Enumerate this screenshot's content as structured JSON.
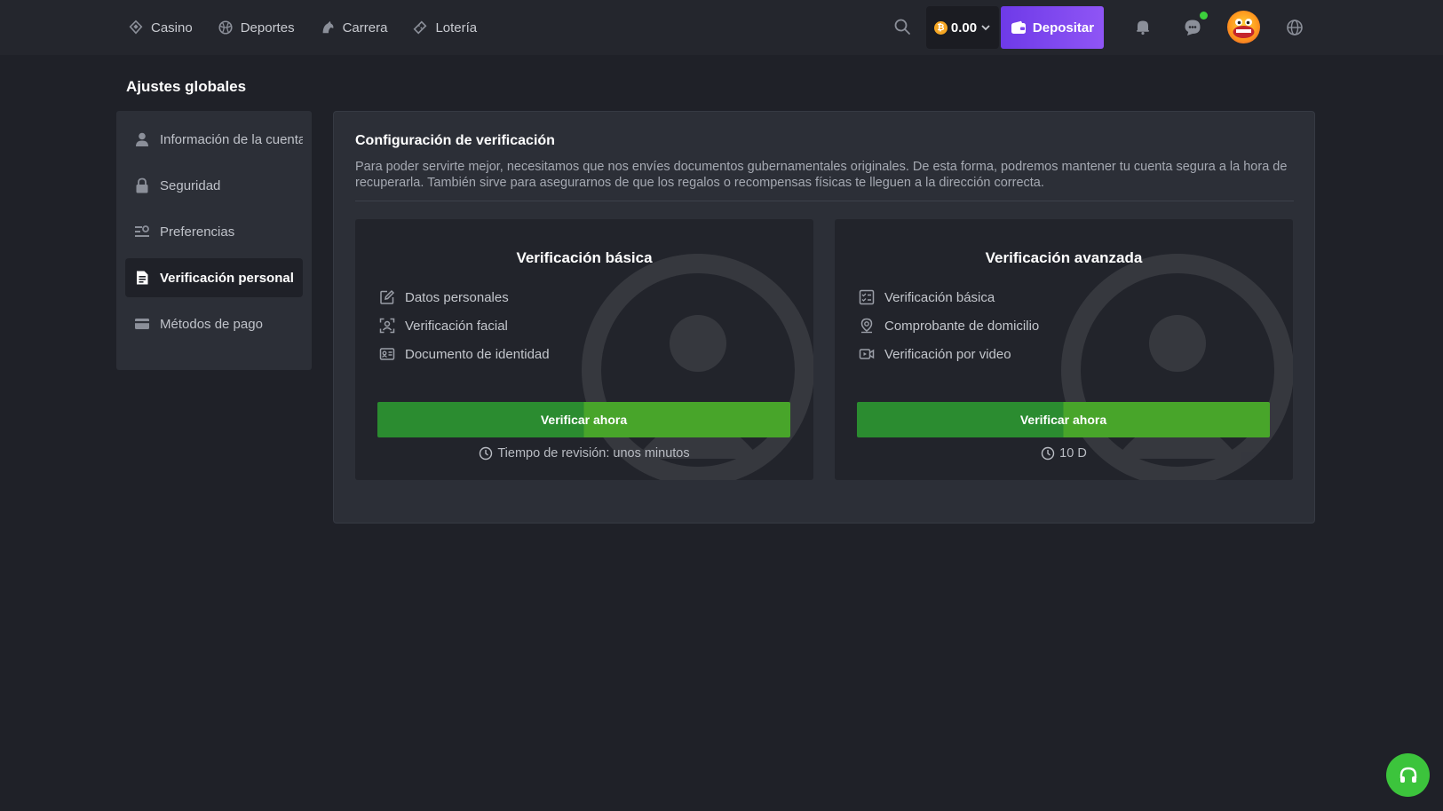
{
  "nav": {
    "items": [
      {
        "label": "Casino",
        "icon": "casino-icon"
      },
      {
        "label": "Deportes",
        "icon": "sports-ball-icon"
      },
      {
        "label": "Carrera",
        "icon": "horse-racing-icon"
      },
      {
        "label": "Lotería",
        "icon": "lottery-ticket-icon"
      }
    ]
  },
  "header": {
    "balance": "0.00",
    "coin_symbol": "₿",
    "deposit_label": "Depositar",
    "accent": "#7d46f0"
  },
  "page": {
    "title": "Ajustes globales"
  },
  "sidebar": {
    "items": [
      {
        "label": "Información de la cuenta",
        "icon": "user-icon"
      },
      {
        "label": "Seguridad",
        "icon": "lock-icon"
      },
      {
        "label": "Preferencias",
        "icon": "preferences-icon"
      },
      {
        "label": "Verificación personal",
        "icon": "document-icon",
        "active": true
      },
      {
        "label": "Métodos de pago",
        "icon": "credit-card-icon"
      }
    ]
  },
  "verification": {
    "title": "Configuración de verificación",
    "description": "Para poder servirte mejor, necesitamos que nos envíes documentos gubernamentales originales. De esta forma, podremos mantener tu cuenta segura a la hora de recuperarla. También sirve para asegurarnos de que los regalos o recompensas físicas te lleguen a la dirección correcta.",
    "cards": [
      {
        "title": "Verificación básica",
        "features": [
          {
            "label": "Datos personales",
            "icon": "edit-icon"
          },
          {
            "label": "Verificación facial",
            "icon": "face-scan-icon"
          },
          {
            "label": "Documento de identidad",
            "icon": "id-card-icon"
          }
        ],
        "button_label": "Verificar ahora",
        "review": "Tiempo de revisión: unos minutos"
      },
      {
        "title": "Verificación avanzada",
        "features": [
          {
            "label": "Verificación básica",
            "icon": "checklist-icon"
          },
          {
            "label": "Comprobante de domicilio",
            "icon": "location-pin-icon"
          },
          {
            "label": "Verificación por video",
            "icon": "video-icon"
          }
        ],
        "button_label": "Verificar ahora",
        "review": "10 D"
      }
    ]
  },
  "colors": {
    "background": "#1f2128",
    "panel": "#2c2f37",
    "button_green": "#3a9a2c",
    "support_green": "#3cc43c"
  }
}
